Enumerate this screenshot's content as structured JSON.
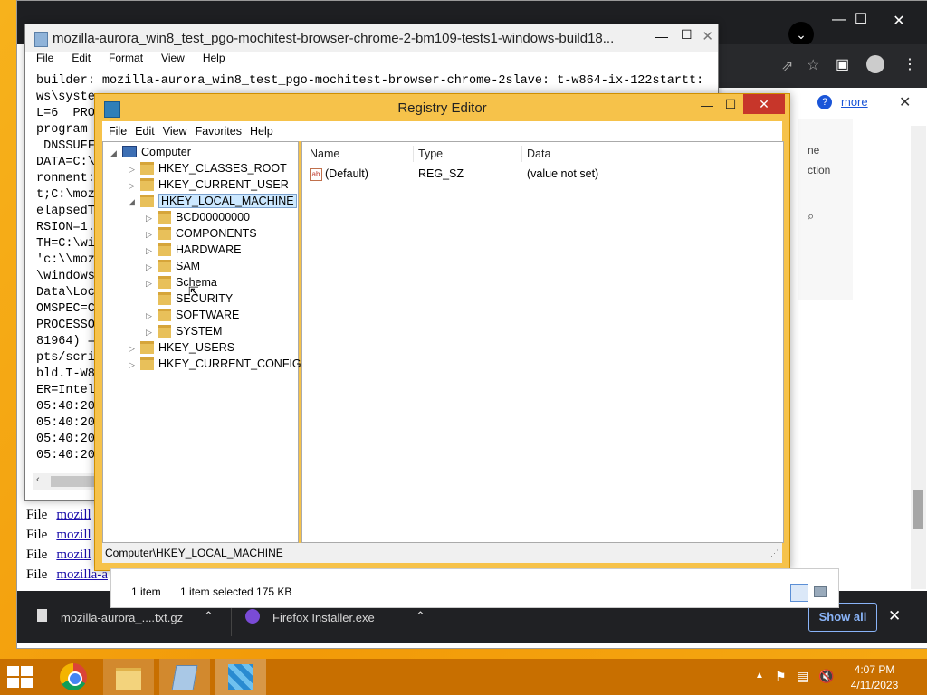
{
  "browser": {
    "minimize": "—",
    "maximize": "☐",
    "close": "✕",
    "info_more": "more",
    "file_label": "File",
    "file_links": [
      "mozill",
      "mozill",
      "mozill",
      "mozilla-a",
      "mozill"
    ],
    "side_texts": [
      "ne",
      "ction"
    ]
  },
  "downloads": {
    "item1": "mozilla-aurora_....txt.gz",
    "item2": "Firefox Installer.exe",
    "show_all": "Show all"
  },
  "notepad": {
    "title": "mozilla-aurora_win8_test_pgo-mochitest-browser-chrome-2-bm109-tests1-windows-build18...",
    "menu": [
      "File",
      "Edit",
      "Format",
      "View",
      "Help"
    ],
    "lines": [
      "builder: mozilla-aurora_win8_test_pgo-mochitest-browser-chrome-2slave: t-w864-ix-122startt:",
      "ws\\syste",
      "L=6  PRO",
      "program",
      " DNSSUFF",
      "DATA=C:\\",
      "ronment:",
      "t;C:\\moz",
      "elapsedT",
      "RSION=1.",
      "TH=C:\\wi",
      "'c:\\\\moz",
      "\\windows",
      "Data\\Loc",
      "OMSPEC=C",
      "PROCESSO",
      "81964) =",
      "pts/scri",
      "bld.T-W8",
      "ER=Intel",
      "05:40:20",
      "05:40:20",
      "05:40:20",
      "05:40:20"
    ]
  },
  "registry": {
    "title": "Registry Editor",
    "menu": [
      "File",
      "Edit",
      "View",
      "Favorites",
      "Help"
    ],
    "tree": {
      "root": "Computer",
      "hkcr": "HKEY_CLASSES_ROOT",
      "hkcu": "HKEY_CURRENT_USER",
      "hklm": "HKEY_LOCAL_MACHINE",
      "children": [
        "BCD00000000",
        "COMPONENTS",
        "HARDWARE",
        "SAM",
        "Schema",
        "SECURITY",
        "SOFTWARE",
        "SYSTEM"
      ],
      "hku": "HKEY_USERS",
      "hkcc": "HKEY_CURRENT_CONFIG"
    },
    "columns": {
      "name": "Name",
      "type": "Type",
      "data": "Data"
    },
    "row": {
      "name": "(Default)",
      "type": "REG_SZ",
      "data": "(value not set)"
    },
    "status": "Computer\\HKEY_LOCAL_MACHINE"
  },
  "explorer": {
    "items": "1 item",
    "selected": "1 item selected  175 KB"
  },
  "tray": {
    "time": "4:07 PM",
    "date": "4/11/2023"
  },
  "colors": {
    "desktop": "#f29a08",
    "taskbar": "#c86f00",
    "registry_frame": "#f6c24a",
    "close_red": "#c7362a"
  }
}
